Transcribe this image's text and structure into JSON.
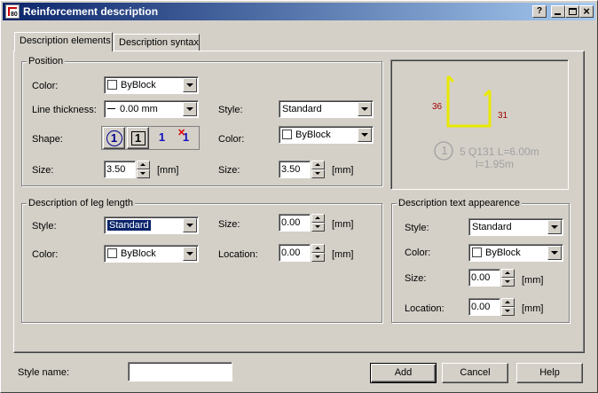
{
  "window": {
    "title": "Reinforcement description",
    "help_btn": "?",
    "min_btn": "_",
    "max_btn": "□",
    "close_btn": "×"
  },
  "tabs": [
    {
      "label": "Description elements",
      "active": true
    },
    {
      "label": "Description syntax",
      "active": false
    }
  ],
  "position": {
    "legend": "Position",
    "color_label": "Color:",
    "color_value": "ByBlock",
    "line_thickness_label": "Line thickness:",
    "line_thickness_value": "0.00 mm",
    "shape_label": "Shape:",
    "shape_options": [
      "1",
      "1",
      "1",
      "1"
    ],
    "size_label": "Size:",
    "size_value": "3.50",
    "size_unit": "[mm]",
    "style_label": "Style:",
    "style_value": "Standard",
    "color2_label": "Color:",
    "color2_value": "ByBlock",
    "size2_label": "Size:",
    "size2_value": "3.50",
    "size2_unit": "[mm]"
  },
  "preview": {
    "dim_left": "36",
    "dim_right": "31",
    "pos_number": "1",
    "line1": "5 Q131 L=6.00m",
    "line2": "l=1.95m",
    "shape_color": "#e8e800",
    "dim_color": "#a00000",
    "text_color": "#a0a0a0"
  },
  "leg_length": {
    "legend": "Description of leg length",
    "style_label": "Style:",
    "style_value": "Standard",
    "color_label": "Color:",
    "color_value": "ByBlock",
    "size_label": "Size:",
    "size_value": "0.00",
    "size_unit": "[mm]",
    "location_label": "Location:",
    "location_value": "0.00",
    "location_unit": "[mm]"
  },
  "text_appearance": {
    "legend": "Description text appearence",
    "style_label": "Style:",
    "style_value": "Standard",
    "color_label": "Color:",
    "color_value": "ByBlock",
    "size_label": "Size:",
    "size_value": "0.00",
    "size_unit": "[mm]",
    "location_label": "Location:",
    "location_value": "0.00",
    "location_unit": "[mm]"
  },
  "footer": {
    "style_name_label": "Style name:",
    "style_name_value": "",
    "add_label": "Add",
    "cancel_label": "Cancel",
    "help_label": "Help"
  }
}
